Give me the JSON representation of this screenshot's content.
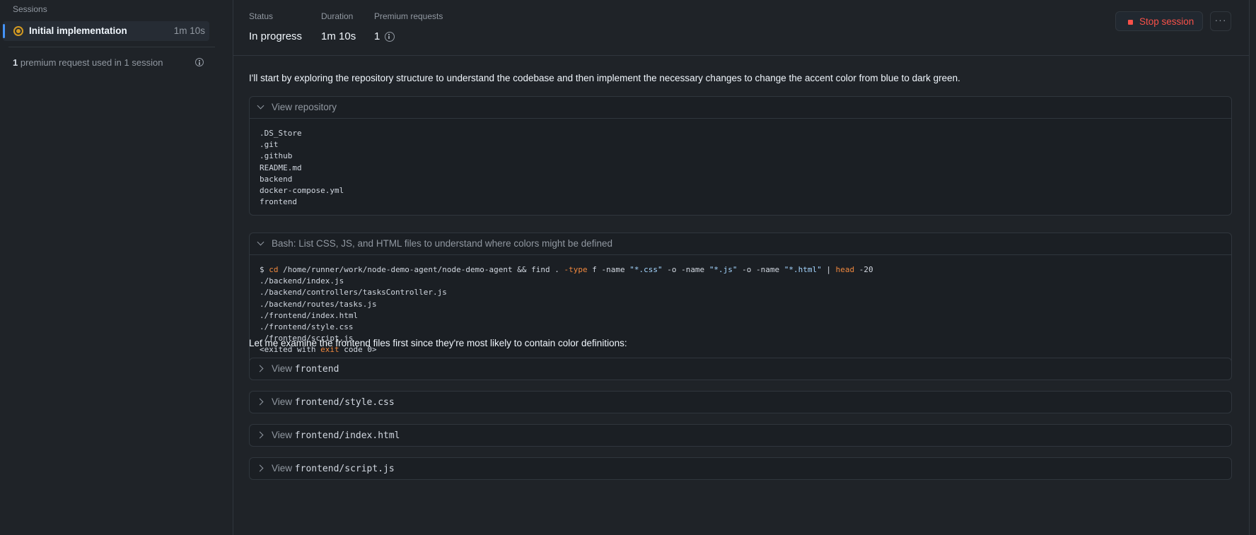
{
  "sidebar": {
    "heading": "Sessions",
    "session": {
      "name": "Initial implementation",
      "duration": "1m 10s"
    },
    "usage_count": "1",
    "usage_text": " premium request used in 1 session"
  },
  "header": {
    "status_label": "Status",
    "status_value": "In progress",
    "duration_label": "Duration",
    "duration_value": "1m 10s",
    "premium_label": "Premium requests",
    "premium_value": "1",
    "stop_label": "Stop session",
    "more_label": "···"
  },
  "log": {
    "intro": "I'll start by exploring the repository structure to understand the codebase and then implement the necessary changes to change the accent color from blue to dark green.",
    "view_repo": {
      "title": "View repository",
      "lines": [
        ".DS_Store",
        ".git",
        ".github",
        "README.md",
        "backend",
        "docker-compose.yml",
        "frontend"
      ]
    },
    "bash": {
      "title": "Bash: List CSS, JS, and HTML files to understand where colors might be defined",
      "prompt": "$ ",
      "cmd_cd": "cd",
      "cmd_path": " /home/runner/work/node-demo-agent/node-demo-agent && find . ",
      "cmd_type_flag": "-type",
      "cmd_f": " f -name ",
      "cmd_css": "\"*.css\"",
      "cmd_o1": " -o -name ",
      "cmd_js": "\"*.js\"",
      "cmd_o2": " -o -name ",
      "cmd_html": "\"*.html\"",
      "cmd_pipe": " | ",
      "cmd_head": "head",
      "cmd_n": " -20",
      "output": [
        "./backend/index.js",
        "./backend/controllers/tasksController.js",
        "./backend/routes/tasks.js",
        "./frontend/index.html",
        "./frontend/style.css",
        "./frontend/script.js"
      ],
      "exit_pre": "<exited with ",
      "exit_kw": "exit",
      "exit_post": " code 0>"
    },
    "examine": "Let me examine the frontend files first since they're most likely to contain color definitions:",
    "views": [
      {
        "verb": "View",
        "path": "frontend"
      },
      {
        "verb": "View",
        "path": "frontend/style.css"
      },
      {
        "verb": "View",
        "path": "frontend/index.html"
      },
      {
        "verb": "View",
        "path": "frontend/script.js"
      }
    ]
  }
}
